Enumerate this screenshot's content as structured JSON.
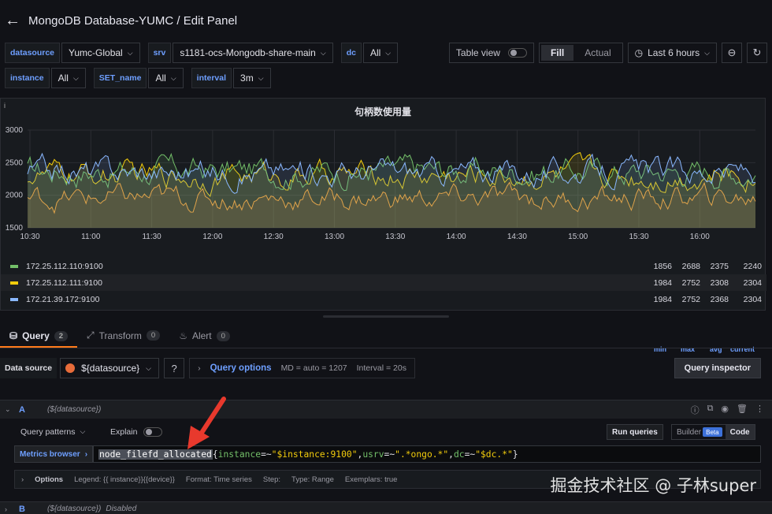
{
  "header": {
    "title": "MongoDB Database-YUMC / Edit Panel"
  },
  "variables": {
    "row1": [
      {
        "label": "datasource",
        "value": "Yumc-Global"
      },
      {
        "label": "srv",
        "value": "s1181-ocs-Mongodb-share-main"
      },
      {
        "label": "dc",
        "value": "All"
      }
    ],
    "row2": [
      {
        "label": "instance",
        "value": "All"
      },
      {
        "label": "SET_name",
        "value": "All"
      },
      {
        "label": "interval",
        "value": "3m"
      }
    ]
  },
  "toolbar": {
    "table_view": "Table view",
    "fill": "Fill",
    "actual": "Actual",
    "time_range": "Last 6 hours"
  },
  "panel": {
    "title": "句柄数使用量",
    "info": "i",
    "legend_headers": {
      "min": "min",
      "max": "max",
      "avg": "avg",
      "current": "current"
    }
  },
  "chart_data": {
    "type": "line",
    "title": "句柄数使用量",
    "x_ticks": [
      "10:30",
      "11:00",
      "11:30",
      "12:00",
      "12:30",
      "13:00",
      "13:30",
      "14:00",
      "14:30",
      "15:00",
      "15:30",
      "16:00"
    ],
    "y_ticks": [
      1500,
      2000,
      2500,
      3000
    ],
    "ylim": [
      1500,
      3000
    ],
    "fill": true,
    "legend_placement": "bottom",
    "series": [
      {
        "name": "172.25.112.110:9100",
        "color": "#73bf69",
        "min": 1856,
        "max": 2688,
        "avg": 2375,
        "current": 2240
      },
      {
        "name": "172.25.112.111:9100",
        "color": "#f2cc0c",
        "min": 1984,
        "max": 2752,
        "avg": 2308,
        "current": 2304
      },
      {
        "name": "172.21.39.172:9100",
        "color": "#8ab8ff",
        "min": 1984,
        "max": 2752,
        "avg": 2368,
        "current": 2304
      }
    ],
    "extra_series_color": "#ff9830"
  },
  "tabs": [
    {
      "label": "Query",
      "count": "2"
    },
    {
      "label": "Transform",
      "count": "0"
    },
    {
      "label": "Alert",
      "count": "0"
    }
  ],
  "query_bar": {
    "data_source_label": "Data source",
    "data_source_value": "${datasource}",
    "query_options": "Query options",
    "md": "MD = auto = 1207",
    "interval": "Interval = 20s",
    "inspector": "Query inspector"
  },
  "query_a": {
    "letter": "A",
    "ds": "(${datasource})",
    "patterns": "Query patterns",
    "explain": "Explain",
    "run": "Run queries",
    "builder": "Builder",
    "beta": "Beta",
    "code": "Code",
    "metrics_browser": "Metrics browser",
    "expr_fn": "node_filefd_allocated",
    "expr_parts": [
      "{",
      "instance",
      "=~",
      "\"$instance:9100\"",
      ",",
      "usrv",
      "=~",
      "\".*ongo.*\"",
      ",",
      "dc",
      "=~",
      "\"$dc.*\"",
      "}"
    ],
    "options_label": "Options",
    "legend": "Legend: {{ instance}}{{device}}",
    "format": "Format: Time series",
    "step": "Step:",
    "type": "Type: Range",
    "exemplars": "Exemplars: true"
  },
  "query_b": {
    "letter": "B",
    "ds": "(${datasource})",
    "status": "Disabled"
  },
  "watermark": "掘金技术社区 @ 子林super"
}
